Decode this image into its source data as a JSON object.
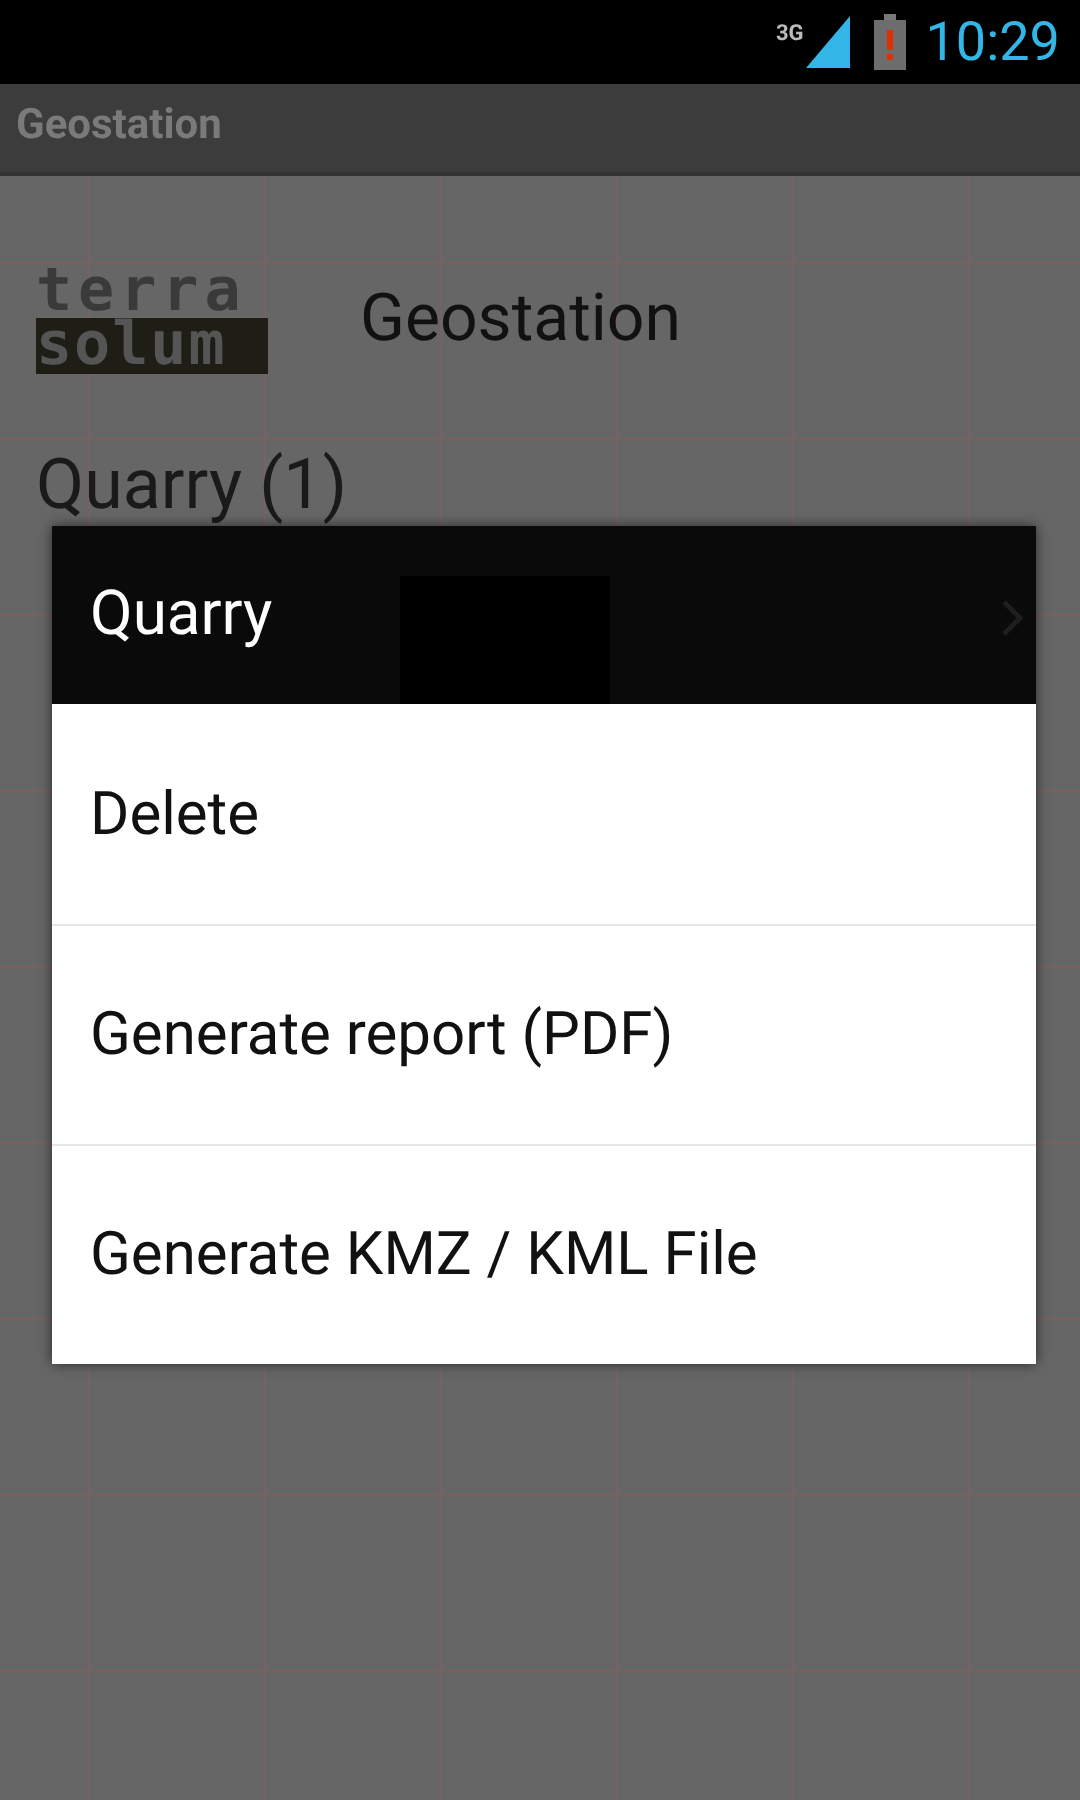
{
  "status_bar": {
    "network": "3G",
    "time": "10:29"
  },
  "action_bar": {
    "title": "Geostation"
  },
  "header": {
    "logo_top": "terra",
    "logo_bottom": "solum",
    "title": "Geostation"
  },
  "list_items": [
    {
      "label": "Quarry (1)"
    }
  ],
  "context_menu": {
    "title": "Quarry",
    "items": [
      {
        "label": "Delete"
      },
      {
        "label": "Generate report (PDF)"
      },
      {
        "label": "Generate KMZ / KML File"
      }
    ]
  }
}
